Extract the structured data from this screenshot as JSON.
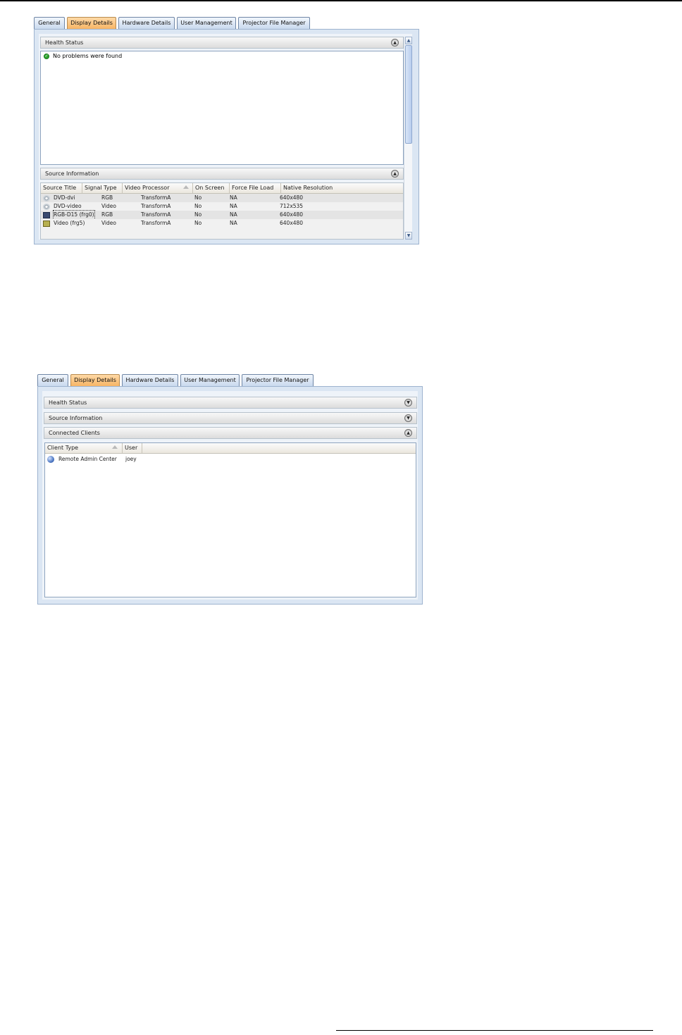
{
  "screen1": {
    "tabs": [
      "General",
      "Display Details",
      "Hardware Details",
      "User Management",
      "Projector File Manager"
    ],
    "active_tab": "Display Details",
    "health_status": {
      "title": "Health Status",
      "message": "No problems were found"
    },
    "source_information": {
      "title": "Source Information",
      "columns": [
        "Source Title",
        "Signal Type",
        "Video Processor",
        "On Screen",
        "Force File Load",
        "Native Resolution"
      ],
      "rows": [
        {
          "icon": "disc-icon",
          "title": "DVD-dvi",
          "signal": "RGB",
          "processor": "TransformA",
          "on_screen": "No",
          "force": "NA",
          "resolution": "640x480"
        },
        {
          "icon": "disc-icon",
          "title": "DVD-video",
          "signal": "Video",
          "processor": "TransformA",
          "on_screen": "No",
          "force": "NA",
          "resolution": "712x535"
        },
        {
          "icon": "monitor-icon",
          "title": "RGB-D15 (frg0)",
          "signal": "RGB",
          "processor": "TransformA",
          "on_screen": "No",
          "force": "NA",
          "resolution": "640x480"
        },
        {
          "icon": "video-icon",
          "title": "Video (frg5)",
          "signal": "Video",
          "processor": "TransformA",
          "on_screen": "No",
          "force": "NA",
          "resolution": "640x480"
        }
      ]
    }
  },
  "screen2": {
    "tabs": [
      "General",
      "Display Details",
      "Hardware Details",
      "User Management",
      "Projector File Manager"
    ],
    "active_tab": "Display Details",
    "sections": [
      "Health Status",
      "Source Information",
      "Connected Clients"
    ],
    "connected_clients": {
      "columns": [
        "Client Type",
        "User"
      ],
      "rows": [
        {
          "icon": "globe-icon",
          "client_type": "Remote Admin Center",
          "user": "joey"
        }
      ]
    }
  },
  "colors": {
    "active_tab": "#f7b565",
    "tab": "#c9d9ee",
    "panel": "#dbe6f3",
    "ok": "#2fa52f"
  }
}
